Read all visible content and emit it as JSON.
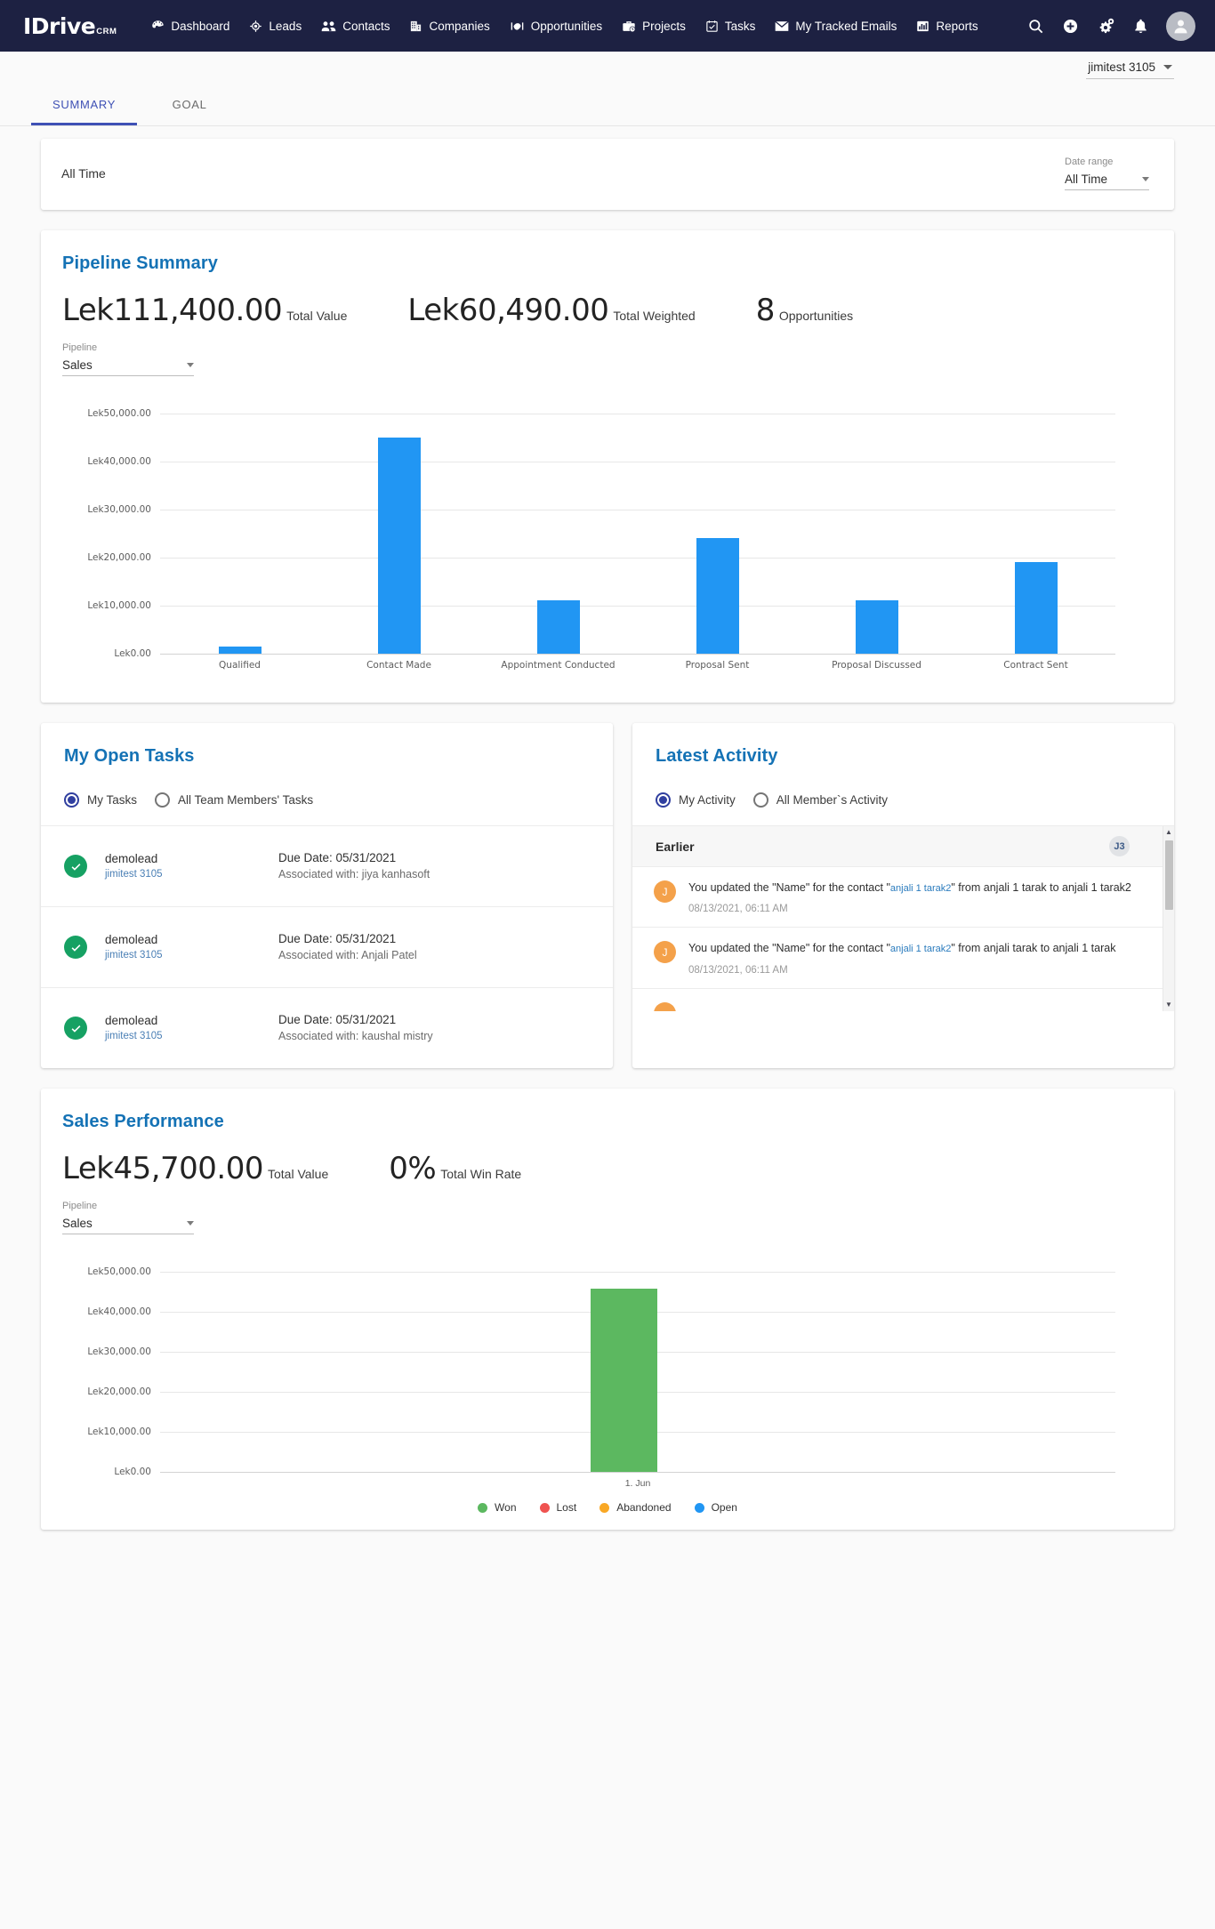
{
  "brand": {
    "name": "IDrive",
    "suffix": "CRM",
    "navbar_color": "#1d2142"
  },
  "navbar": {
    "items": [
      {
        "label": "Dashboard",
        "icon": "dashboard-icon"
      },
      {
        "label": "Leads",
        "icon": "leads-icon"
      },
      {
        "label": "Contacts",
        "icon": "contacts-icon"
      },
      {
        "label": "Companies",
        "icon": "companies-icon"
      },
      {
        "label": "Opportunities",
        "icon": "opportunities-icon"
      },
      {
        "label": "Projects",
        "icon": "projects-icon"
      },
      {
        "label": "Tasks",
        "icon": "tasks-icon"
      },
      {
        "label": "My Tracked Emails",
        "icon": "email-icon"
      },
      {
        "label": "Reports",
        "icon": "reports-icon"
      }
    ],
    "actions": [
      "search-icon",
      "add-icon",
      "settings-icon",
      "notifications-icon",
      "avatar"
    ]
  },
  "user_selector": {
    "name": "jimitest 3105"
  },
  "tabs": [
    {
      "label": "SUMMARY",
      "active": true
    },
    {
      "label": "GOAL",
      "active": false
    }
  ],
  "date_range_card": {
    "current_range_text": "All Time",
    "field_label": "Date range",
    "field_value": "All Time"
  },
  "pipeline_summary": {
    "title": "Pipeline Summary",
    "metrics": [
      {
        "value": "Lek111,400.00",
        "label": "Total Value"
      },
      {
        "value": "Lek60,490.00",
        "label": "Total Weighted"
      },
      {
        "value": "8",
        "label": "Opportunities"
      }
    ],
    "pipeline_field_label": "Pipeline",
    "pipeline_field_value": "Sales"
  },
  "open_tasks": {
    "title": "My Open Tasks",
    "options": [
      {
        "label": "My Tasks",
        "checked": true
      },
      {
        "label": "All Team Members' Tasks",
        "checked": false
      }
    ],
    "rows": [
      {
        "name": "demolead",
        "owner": "jimitest 3105",
        "due": "Due Date: 05/31/2021",
        "associated": "Associated with: jiya kanhasoft"
      },
      {
        "name": "demolead",
        "owner": "jimitest 3105",
        "due": "Due Date: 05/31/2021",
        "associated": "Associated with: Anjali Patel"
      },
      {
        "name": "demolead",
        "owner": "jimitest 3105",
        "due": "Due Date: 05/31/2021",
        "associated": "Associated with: kaushal mistry"
      }
    ]
  },
  "latest_activity": {
    "title": "Latest Activity",
    "options": [
      {
        "label": "My Activity",
        "checked": true
      },
      {
        "label": "All Member`s Activity",
        "checked": false
      }
    ],
    "group_header": "Earlier",
    "group_badge": "J3",
    "items": [
      {
        "avatar": "J",
        "prefix": "You updated the \"Name\" for the contact \"",
        "link": "anjali 1 tarak2",
        "suffix": "\" from anjali 1 tarak to anjali 1 tarak2",
        "time": "08/13/2021, 06:11 AM"
      },
      {
        "avatar": "J",
        "prefix": "You updated the \"Name\" for the contact \"",
        "link": "anjali 1 tarak2",
        "suffix": "\" from anjali tarak to anjali 1 tarak",
        "time": "08/13/2021, 06:11 AM"
      }
    ]
  },
  "sales_performance": {
    "title": "Sales Performance",
    "metrics": [
      {
        "value": "Lek45,700.00",
        "label": "Total Value"
      },
      {
        "value": "0%",
        "label": "Total Win Rate"
      }
    ],
    "pipeline_field_label": "Pipeline",
    "pipeline_field_value": "Sales",
    "legend": [
      {
        "label": "Won",
        "color": "#5cb860"
      },
      {
        "label": "Lost",
        "color": "#ef5350"
      },
      {
        "label": "Abandoned",
        "color": "#f9a825"
      },
      {
        "label": "Open",
        "color": "#2196f3"
      }
    ]
  },
  "chart_data": [
    {
      "type": "bar",
      "title": "Pipeline Summary",
      "categories": [
        "Qualified",
        "Contact Made",
        "Appointment Conducted",
        "Proposal Sent",
        "Proposal Discussed",
        "Contract Sent"
      ],
      "values": [
        1400,
        45000,
        11200,
        24000,
        11200,
        19000
      ],
      "bar_color": "#2196f3",
      "xlabel": "",
      "ylabel": "",
      "ylim": [
        0,
        50000
      ],
      "ytick_labels": [
        "Lek50,000.00",
        "Lek40,000.00",
        "Lek30,000.00",
        "Lek20,000.00",
        "Lek10,000.00",
        "Lek0.00"
      ],
      "ytick_values": [
        50000,
        40000,
        30000,
        20000,
        10000,
        0
      ],
      "grid": true,
      "legend": "none"
    },
    {
      "type": "bar",
      "title": "Sales Performance",
      "categories": [
        "1. Jun"
      ],
      "series": [
        {
          "name": "Won",
          "values": [
            45700
          ],
          "color": "#5cb860"
        },
        {
          "name": "Lost",
          "values": [
            0
          ],
          "color": "#ef5350"
        },
        {
          "name": "Abandoned",
          "values": [
            0
          ],
          "color": "#f9a825"
        },
        {
          "name": "Open",
          "values": [
            0
          ],
          "color": "#2196f3"
        }
      ],
      "xlabel": "",
      "ylabel": "",
      "ylim": [
        0,
        50000
      ],
      "ytick_labels": [
        "Lek50,000.00",
        "Lek40,000.00",
        "Lek30,000.00",
        "Lek20,000.00",
        "Lek10,000.00",
        "Lek0.00"
      ],
      "ytick_values": [
        50000,
        40000,
        30000,
        20000,
        10000,
        0
      ],
      "grid": true,
      "legend": "bottom-center"
    }
  ]
}
